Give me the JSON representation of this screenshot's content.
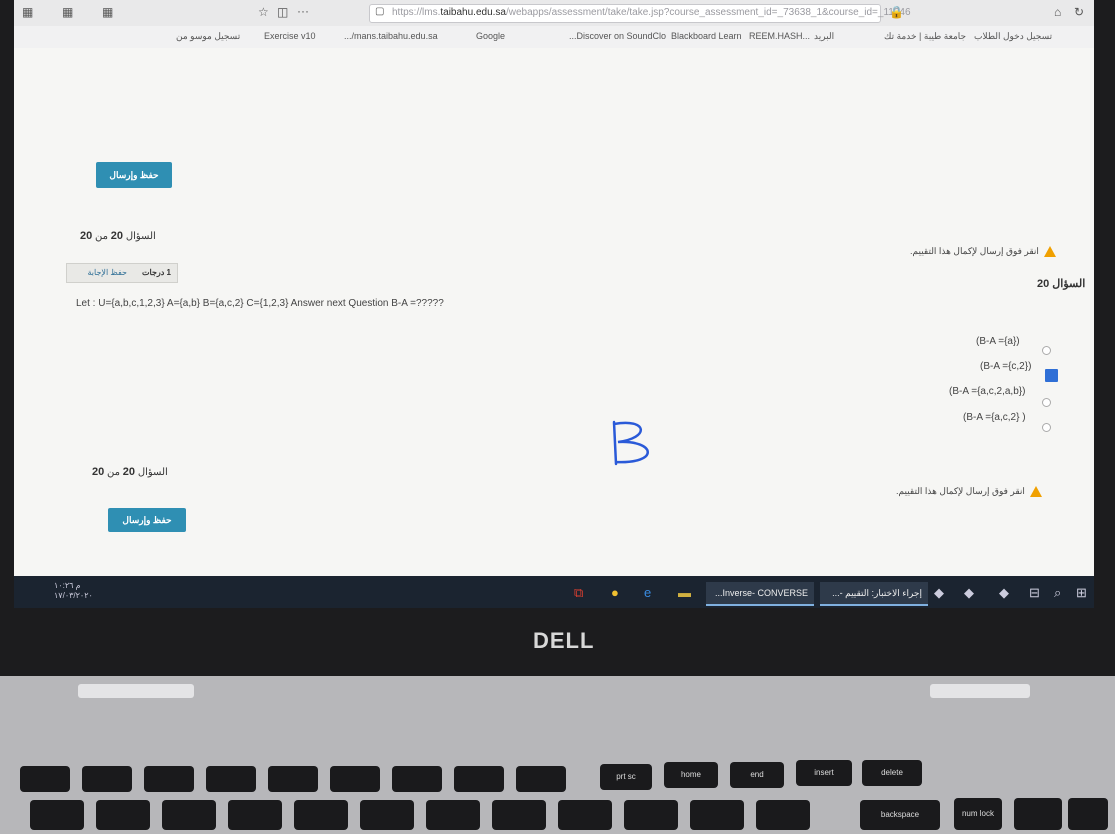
{
  "browser": {
    "url_prefix": "https://lms.",
    "url_host": "taibahu.edu.sa",
    "url_path": "/webapps/assessment/take/take.jsp?course_assessment_id=_73638_1&course_id=_11346",
    "bookmarks": [
      "تسجيل دخول الطلاب",
      "جامعة طيبة | خدمة تك",
      "البريد",
      "...REEM.HASH",
      "Blackboard Learn",
      "Discover on SoundClo...",
      "Google",
      "mans.taibahu.edu.sa/...",
      "Exercise v10",
      "تسجيل موسو من"
    ]
  },
  "page": {
    "save_submit_label": "حفظ وإرسال",
    "question_counter": {
      "label": "السؤال",
      "current": "20",
      "of": "من",
      "total": "20"
    },
    "warning_text": "انقر فوق إرسال لإكمال هذا التقييم.",
    "question_badge": {
      "points": "1 درجات",
      "save_answer": "حفظ الإجابة"
    },
    "question_title": "السؤال 20",
    "question_text": "Let : U={a,b,c,1,2,3} A={a,b} B={a,c,2} C={1,2,3} Answer next Question B-A =?????",
    "options": [
      {
        "label": "(B-A ={a})",
        "selected": false
      },
      {
        "label": "(B-A ={c,2})",
        "selected": true
      },
      {
        "label": "(B-A ={a,c,2,a,b})",
        "selected": false
      },
      {
        "label": "(B-A ={a,c,2} )",
        "selected": false
      }
    ],
    "handwritten_mark": "B"
  },
  "taskbar": {
    "clock": "م ١٠:٢٦\n١٧/٠٣/٢٠٢٠",
    "window1": "Inverse- CONVERSE...",
    "window2": "إجراء الاختبار: التقييم -..."
  },
  "hardware": {
    "brand": "DELL",
    "keys": [
      "prt sc",
      "home",
      "end",
      "insert",
      "delete",
      "backspace",
      "num lock"
    ]
  },
  "colors": {
    "button": "#2f8fb3",
    "warning": "#f0a000",
    "selected_radio": "#2f6fd6",
    "taskbar": "#1b2430"
  }
}
